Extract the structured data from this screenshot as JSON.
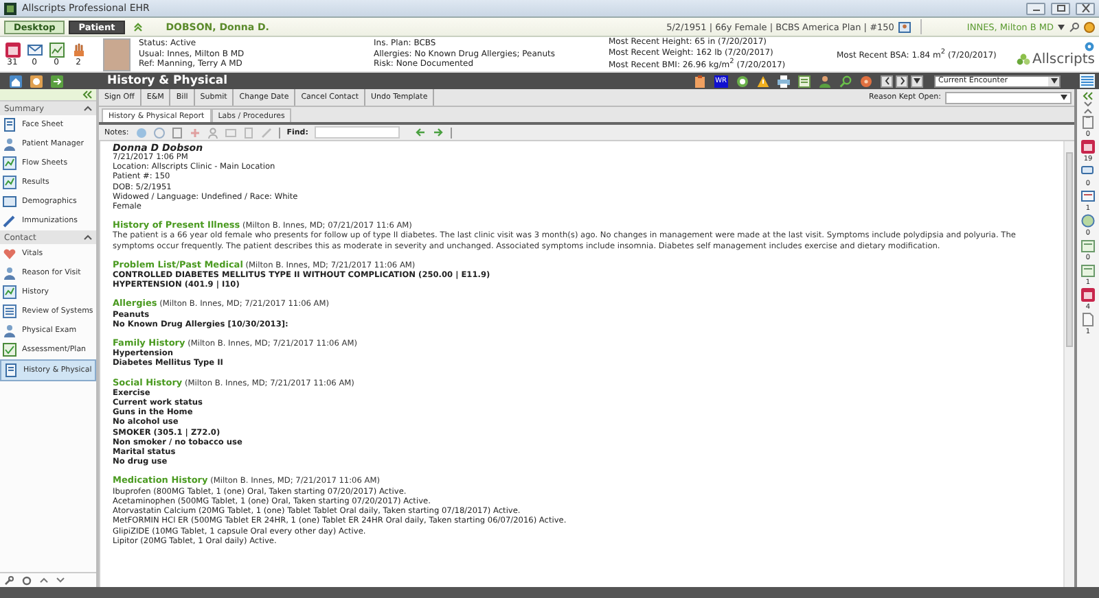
{
  "window": {
    "title": "Allscripts Professional EHR"
  },
  "workspace_tabs": [
    {
      "label": "Desktop",
      "selected": false
    },
    {
      "label": "Patient",
      "selected": true
    }
  ],
  "patient": {
    "name": "DOBSON, Donna D.",
    "summary": "5/2/1951  |  66y Female  |  BCBS America Plan  |  #150"
  },
  "user": {
    "name": "INNES, Milton B MD"
  },
  "banner": {
    "counters": [
      "31",
      "0",
      "0",
      "2"
    ],
    "status": [
      "Status: Active",
      "Usual: Innes, Milton B MD",
      "Ref: Manning, Terry A MD"
    ],
    "insurance": [
      "Ins. Plan: BCBS",
      "Allergies: No Known Drug Allergies; Peanuts",
      "Risk: None Documented"
    ],
    "measures": [
      "Most Recent Height: 65 in (7/20/2017)",
      "Most Recent Weight: 162 lb (7/20/2017)",
      "Most Recent BMI: 26.96 kg/m$^{2}$ (7/20/2017)"
    ],
    "bsa": "Most Recent BSA: 1.84 m$^{2}$ (7/20/2017)",
    "logo": "Allscripts"
  },
  "page": {
    "title": "History & Physical",
    "wr_badge": "WR",
    "encounter": "Current Encounter"
  },
  "sidebar": {
    "groups": [
      {
        "label": "Summary",
        "expanded": true,
        "items": [
          {
            "label": "Face Sheet",
            "selected": false
          },
          {
            "label": "Patient Manager",
            "selected": false
          },
          {
            "label": "Flow Sheets",
            "selected": false
          },
          {
            "label": "Results",
            "selected": false
          },
          {
            "label": "Demographics",
            "selected": false
          },
          {
            "label": "Immunizations",
            "selected": false
          }
        ]
      },
      {
        "label": "Contact",
        "expanded": true,
        "items": [
          {
            "label": "Vitals",
            "selected": false
          },
          {
            "label": "Reason for Visit",
            "selected": false
          },
          {
            "label": "History",
            "selected": false
          },
          {
            "label": "Review of Systems",
            "selected": false
          },
          {
            "label": "Physical Exam",
            "selected": false
          },
          {
            "label": "Assessment/Plan",
            "selected": false
          },
          {
            "label": "History & Physical",
            "selected": true
          }
        ]
      }
    ]
  },
  "actions": [
    "Sign Off",
    "E&M",
    "Bill",
    "Submit",
    "Change Date",
    "Cancel Contact",
    "Undo Template"
  ],
  "reason_kept_open": {
    "label": "Reason Kept Open:"
  },
  "doc_tabs": [
    {
      "label": "History & Physical Report",
      "selected": true
    },
    {
      "label": "Labs / Procedures",
      "selected": false
    }
  ],
  "notes_toolbar": {
    "label": "Notes:",
    "find_label": "Find:"
  },
  "document": {
    "name": "Donna D Dobson",
    "lines": [
      "7/21/2017 1:06 PM",
      "Location: Allscripts Clinic - Main Location",
      "Patient #: 150",
      "DOB: 5/2/1951",
      "Widowed / Language: Undefined / Race: White",
      "Female"
    ],
    "sections": [
      {
        "title": "History of Present Illness",
        "meta": "(Milton B. Innes, MD; 07/21/2017 11:6 AM)",
        "kind": "paragraph",
        "lines": [
          "The patient is a 66 year old female who presents for follow up of type II diabetes. The last clinic visit was 3 month(s) ago. No changes in management were made at the last visit. Symptoms include polydipsia and polyuria. The symptoms occur frequently. The patient describes this as moderate in severity and unchanged. Associated symptoms include insomnia. Diabetes self management includes exercise and dietary modification."
        ]
      },
      {
        "title": "Problem List/Past Medical",
        "meta": "(Milton B. Innes, MD; 7/21/2017 11:06 AM)",
        "kind": "bold",
        "lines": [
          "CONTROLLED DIABETES MELLITUS TYPE II WITHOUT COMPLICATION (250.00 | E11.9)",
          "HYPERTENSION (401.9 | I10)"
        ]
      },
      {
        "title": "Allergies",
        "meta": "(Milton B. Innes, MD; 7/21/2017 11:06 AM)",
        "kind": "bold",
        "lines": [
          "Peanuts",
          "No Known Drug Allergies  [10/30/2013]:"
        ]
      },
      {
        "title": "Family History",
        "meta": "(Milton B. Innes, MD; 7/21/2017 11:06 AM)",
        "kind": "bold",
        "lines": [
          "Hypertension",
          "Diabetes Mellitus Type II"
        ]
      },
      {
        "title": "Social History",
        "meta": "(Milton B. Innes, MD; 7/21/2017 11:06 AM)",
        "kind": "bold",
        "lines": [
          "Exercise",
          "Current work status",
          "Guns in the Home",
          "No alcohol use",
          "SMOKER (305.1 | Z72.0)",
          "Non smoker / no tobacco use",
          "Marital status",
          "No drug use"
        ]
      },
      {
        "title": "Medication History",
        "meta": "(Milton B. Innes, MD; 7/21/2017 11:06 AM)",
        "kind": "plain",
        "lines": [
          "Ibuprofen  (800MG Tablet, 1 (one) Oral, Taken starting 07/20/2017) Active.",
          "Acetaminophen  (500MG Tablet, 1 (one) Oral, Taken starting 07/20/2017) Active.",
          "Atorvastatin Calcium  (20MG Tablet, 1 (one) Tablet Tablet Oral daily, Taken starting 07/18/2017) Active.",
          "MetFORMIN HCl ER  (500MG Tablet ER 24HR, 1 (one) Tablet ER 24HR Oral daily, Taken starting 06/07/2016) Active.",
          "GlipiZIDE  (10MG Tablet, 1 capsule Oral every other day) Active.",
          "Lipitor  (20MG Tablet, 1 Oral daily) Active."
        ]
      }
    ]
  },
  "right_rail": [
    "0",
    "19",
    "0",
    "1",
    "0",
    "0",
    "1",
    "4",
    "1"
  ]
}
